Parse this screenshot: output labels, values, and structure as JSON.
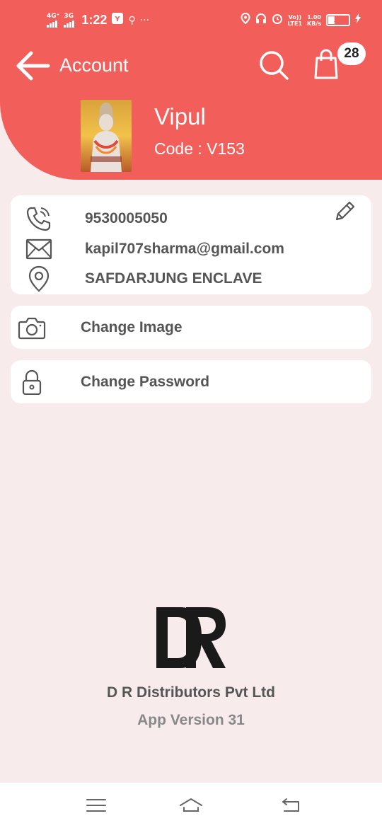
{
  "status_bar": {
    "net1": "4G⁺",
    "net2": "3G",
    "time": "1:22",
    "more": "···",
    "volte": "Vo))\nLTE1",
    "speed": "1.00\nKB/s",
    "battery_level": "33",
    "battery_fraction": 0.33
  },
  "header": {
    "title": "Account",
    "cart_count": "28"
  },
  "profile": {
    "name": "Vipul",
    "code": "Code : V153"
  },
  "contact": {
    "phone": "9530005050",
    "email": "kapil707sharma@gmail.com",
    "address": "SAFDARJUNG ENCLAVE"
  },
  "actions": {
    "change_image": "Change Image",
    "change_password": "Change Password"
  },
  "footer": {
    "company": "D R Distributors Pvt Ltd",
    "version": "App Version 31"
  },
  "colors": {
    "accent": "#f25f5a",
    "background": "#f8ebeb",
    "text": "#555555"
  },
  "icons": [
    "back-arrow-icon",
    "search-icon",
    "shopping-bag-icon",
    "phone-icon",
    "mail-icon",
    "location-pin-icon",
    "pencil-icon",
    "camera-icon",
    "lock-icon",
    "menu-icon",
    "home-icon",
    "back-icon"
  ]
}
